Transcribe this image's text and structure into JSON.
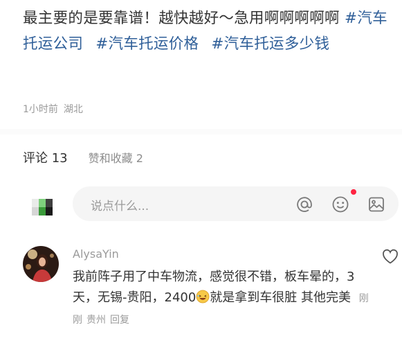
{
  "post": {
    "text": "最主要的是要靠谱！越快越好～急用啊啊啊啊啊",
    "hashtags": [
      "#汽车托运公司",
      "#汽车托运价格",
      "#汽车托运多少钱"
    ],
    "time": "1小时前",
    "location": "湖北"
  },
  "tabs": {
    "comments": "评论 13",
    "likes": "赞和收藏 2"
  },
  "composer": {
    "placeholder": "说点什么...",
    "icons": [
      "at-icon",
      "emoji-icon",
      "image-icon"
    ],
    "notify_color": "#ff2442"
  },
  "comment": {
    "author": "AlysaYin",
    "text_part1": "我前阵子用了中车物流，感觉很不错，板车晕的，3天，无锡-贵阳，2400",
    "text_part2": "就是拿到车很脏 其他完美",
    "time": "刚刚",
    "location": "贵州",
    "reply": "回复"
  },
  "colors": {
    "hashtag": "#2f5f99",
    "text": "#333333",
    "muted": "#9a9a9a"
  }
}
